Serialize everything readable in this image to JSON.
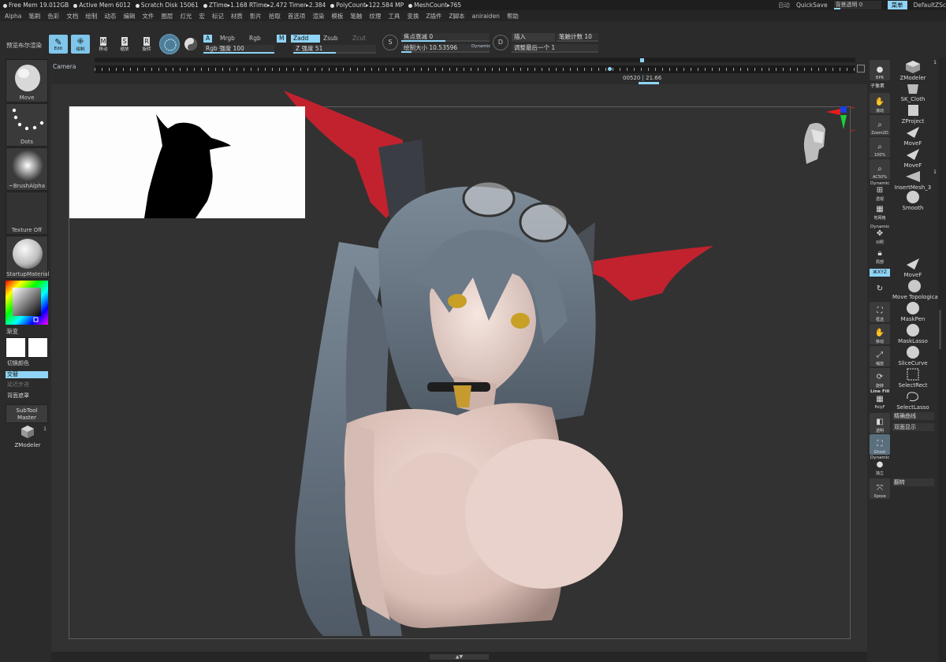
{
  "status": {
    "stats": [
      "Free Mem 19.012GB",
      "Active Mem 6012",
      "Scratch Disk 15061",
      "ZTime▸1.168 RTime▸2.472 Timer▸2.384",
      "PolyCount▸122.584 MP",
      "MeshCount▸765"
    ],
    "auto": "自动",
    "quicksave": "QuickSave",
    "bg_transparency": "背景透明 0",
    "menu_button": "菜单",
    "default_script": "DefaultZSc"
  },
  "menu": [
    "Alpha",
    "笔刷",
    "色彩",
    "文档",
    "绘制",
    "动态",
    "编辑",
    "文件",
    "图层",
    "灯光",
    "宏",
    "标记",
    "材质",
    "影片",
    "拾取",
    "首选项",
    "渲染",
    "模板",
    "笔触",
    "纹理",
    "工具",
    "变换",
    "Z插件",
    "Z脚本",
    "aniraiden",
    "帮助"
  ],
  "toolbar": {
    "preview_render": "预览布尔渲染",
    "edit": "Edit",
    "draw": "绘制",
    "move": "移动",
    "scale": "缩放",
    "rotate": "旋转",
    "a_label": "A",
    "mrgb": "Mrgb",
    "rgb": "Rgb",
    "m_label": "M",
    "zadd": "Zadd",
    "zsub": "Zsub",
    "zcut": "Zcut",
    "rgb_intensity": "Rgb 强度 100",
    "z_intensity": "Z 强度 51",
    "focal_shift": "焦点衰减 0",
    "draw_size": "绘制大小 10.53596",
    "dynamic": "Dynamic",
    "insert": "插入",
    "stroke_count": "笔触计数 10",
    "adjust_last": "调整最后一个 1",
    "rgb_intensity_value": 1.0,
    "z_intensity_value": 0.51,
    "draw_size_value": 0.12,
    "focal_value": 0.5
  },
  "timeline": {
    "camera": "Camera",
    "time": "00520",
    "time2": "21.66"
  },
  "left_shelf": {
    "move": "Move",
    "dots": "Dots",
    "brush_alpha": "~BrushAlpha",
    "texture_off": "Texture Off",
    "material": "StartupMaterial",
    "gradient": "渐变",
    "switch_color": "切换颜色",
    "alternate": "交替",
    "delay_progress": "延迟步进",
    "backface_mask": "背面遮罩",
    "subtool_master": "SubTool\nMaster",
    "zmodeler": "ZModeler",
    "zmodeler_count": "1",
    "main_color": "#ffffff",
    "secondary_color": "#ffffff"
  },
  "right_shelf": {
    "bpr": "BPR",
    "subpixel": "子像素",
    "scroll": "滚动",
    "zoom2d": "Zoom2D",
    "pct100": "100%",
    "ac50": "AC50%",
    "dynamic": "Dynamic",
    "perspective": "透视",
    "floor": "地网格",
    "dynamic2": "Dynamic",
    "solo": "对照",
    "local": "局部",
    "xyz": "⌘XYZ",
    "frame": "框选",
    "move": "移动",
    "zoom": "缩放",
    "rotate": "旋转",
    "linefill": "Line Fill",
    "polyf": "PolyF",
    "transparent": "透明",
    "ghost": "Ghost",
    "dynamic3": "Dynamic",
    "solo2": "独立",
    "xpose": "Xpose"
  },
  "subtools": {
    "zmodeler": "ZModeler",
    "zmodeler_count": "1",
    "sk_cloth": "SK_Cloth",
    "zproject": "ZProject",
    "movef1": "MoveF",
    "movef2": "MoveF",
    "insertmesh": "InsertMesh_3",
    "insertmesh_count": "1",
    "smooth": "Smooth",
    "movef3": "MoveF",
    "move_topo": "Move Topologica",
    "maskpen": "MaskPen",
    "masklasso": "MaskLasso",
    "slicecurve": "SliceCurve",
    "selectrect": "SelectRect",
    "selectlasso": "SelectLasso",
    "precise_curve": "精确曲线",
    "double_display": "双面显示",
    "flip": "翻转"
  },
  "bottom": {
    "handle": "▲▼"
  }
}
